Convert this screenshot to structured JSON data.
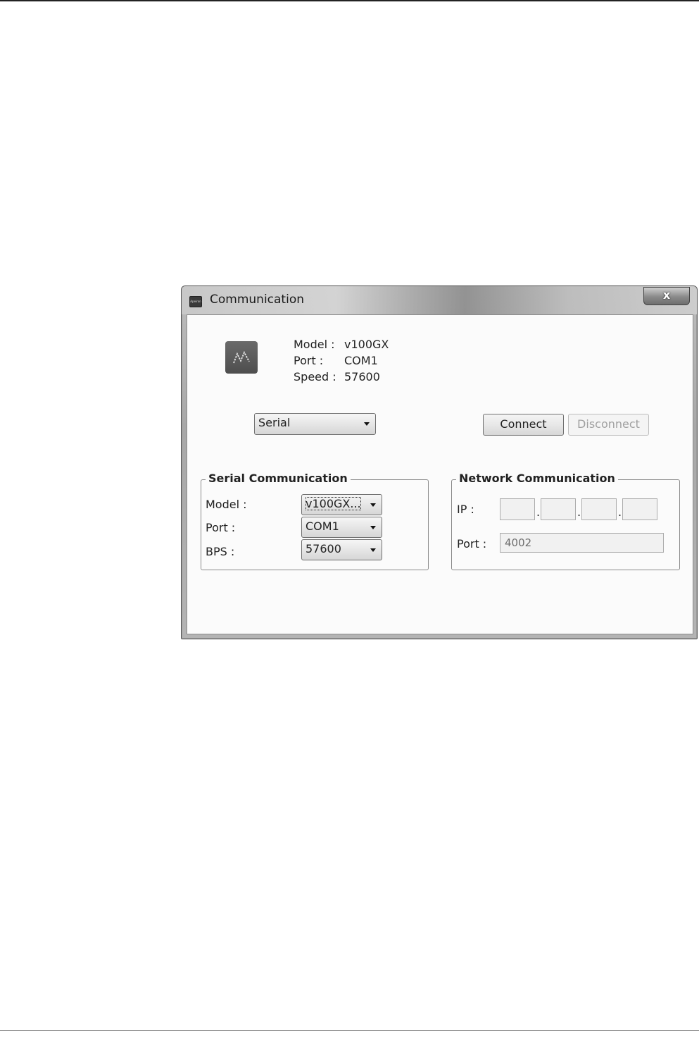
{
  "window": {
    "title": "Communication",
    "app_icon_text": "Apeiron",
    "close_label": "x"
  },
  "status": {
    "model_label": "Model :",
    "model_value": "v100GX",
    "port_label": "Port :",
    "port_value": "COM1",
    "speed_label": "Speed :",
    "speed_value": "57600"
  },
  "mode_select": {
    "value": "Serial"
  },
  "buttons": {
    "connect": "Connect",
    "disconnect": "Disconnect"
  },
  "serial": {
    "legend": "Serial Communication",
    "model_label": "Model :",
    "model_value": "v100GX...",
    "port_label": "Port :",
    "port_value": "COM1",
    "bps_label": "BPS :",
    "bps_value": "57600"
  },
  "network": {
    "legend": "Network Communication",
    "ip_label": "IP :",
    "ip_octets": [
      "",
      "",
      "",
      ""
    ],
    "ip_separator": ".",
    "port_label": "Port :",
    "port_value": "4002"
  },
  "colors": {
    "logo_tile": "#555555",
    "window_frame": "#a8a8a8"
  },
  "icons": {
    "logo": "app-logo-icon",
    "close": "close-icon",
    "dropdown": "chevron-down-icon"
  }
}
